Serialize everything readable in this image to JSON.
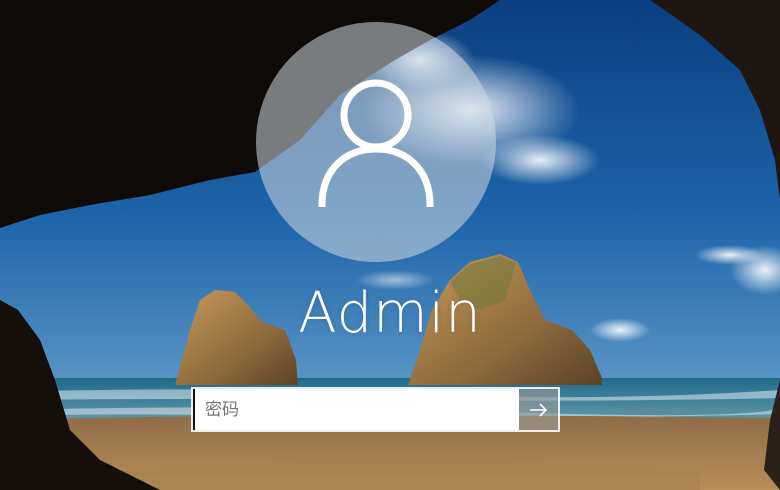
{
  "user": {
    "name": "Admin"
  },
  "password": {
    "placeholder": "密码",
    "value": ""
  },
  "icons": {
    "avatar": "user-silhouette-icon",
    "submit": "arrow-right-icon"
  },
  "colors": {
    "sky": "#1a5c9e",
    "sea": "#2a6f8e",
    "sand": "#a27a4c",
    "cave": "#0d0a08",
    "avatar_bg": "#c9d2da",
    "text": "#ffffff",
    "field_bg": "#ffffff",
    "placeholder": "#777777"
  }
}
